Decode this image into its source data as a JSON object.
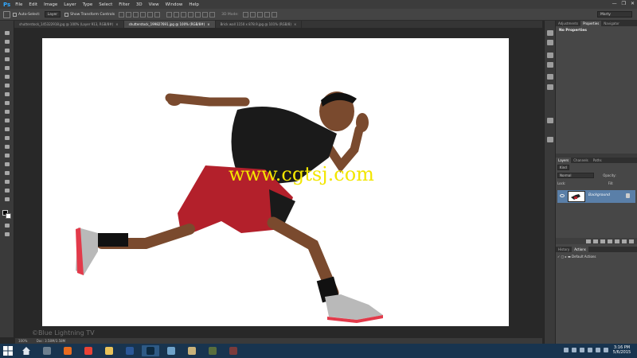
{
  "app": {
    "logo": "Ps"
  },
  "menu": [
    "File",
    "Edit",
    "Image",
    "Layer",
    "Type",
    "Select",
    "Filter",
    "3D",
    "View",
    "Window",
    "Help"
  ],
  "window_controls": [
    "—",
    "❐",
    "✕"
  ],
  "options_bar": {
    "auto_select_label": "Auto-Select:",
    "auto_select_value": "Layer",
    "transform_label": "Show Transform Controls",
    "mode_label": "3D Mode:",
    "workspace": "Marty"
  },
  "tabs": [
    {
      "label": "shutterstock_145322918.jpg @ 100% (Layer 913, RGB/8#)",
      "active": false
    },
    {
      "label": "shutterstock_199827691.jpg @ 100% (RGB/8#)",
      "active": true
    },
    {
      "label": "Brick wall 1150 x 878.9.jpg @ 101% (RGB/8)",
      "active": false
    }
  ],
  "canvas": {
    "watermark": "www.cgtsj.com",
    "credit": "©Blue Lightning TV"
  },
  "status": {
    "zoom": "100%",
    "doc": "Doc: 3.58M/3.58M"
  },
  "panels": {
    "top_tabs": [
      "Adjustments",
      "Properties",
      "Navigator"
    ],
    "no_properties": "No Properties",
    "layers_tabs": [
      "Layers",
      "Channels",
      "Paths"
    ],
    "kind_label": "Kind",
    "blend_mode": "Normal",
    "opacity_label": "Opacity:",
    "lock_label": "Lock:",
    "fill_label": "Fill:",
    "layer_name": "Background",
    "history_tabs": [
      "History",
      "Actions"
    ],
    "default_actions": "Default Actions"
  },
  "taskbar": {
    "time": "3:16 PM",
    "date": "5/6/2015",
    "apps": [
      {
        "name": "shield-app",
        "color": "#6d7f8f"
      },
      {
        "name": "firefox",
        "color": "#e86b1f"
      },
      {
        "name": "chrome",
        "color": "#e94235"
      },
      {
        "name": "file-explorer",
        "color": "#e8c25a"
      },
      {
        "name": "word",
        "color": "#2b5797"
      },
      {
        "name": "photoshop",
        "color": "#0d2a40"
      },
      {
        "name": "image-viewer",
        "color": "#6fa2c9"
      },
      {
        "name": "folder",
        "color": "#c9b27a"
      },
      {
        "name": "media-app",
        "color": "#586e3d"
      },
      {
        "name": "tool-app",
        "color": "#7a3b3b"
      }
    ]
  }
}
